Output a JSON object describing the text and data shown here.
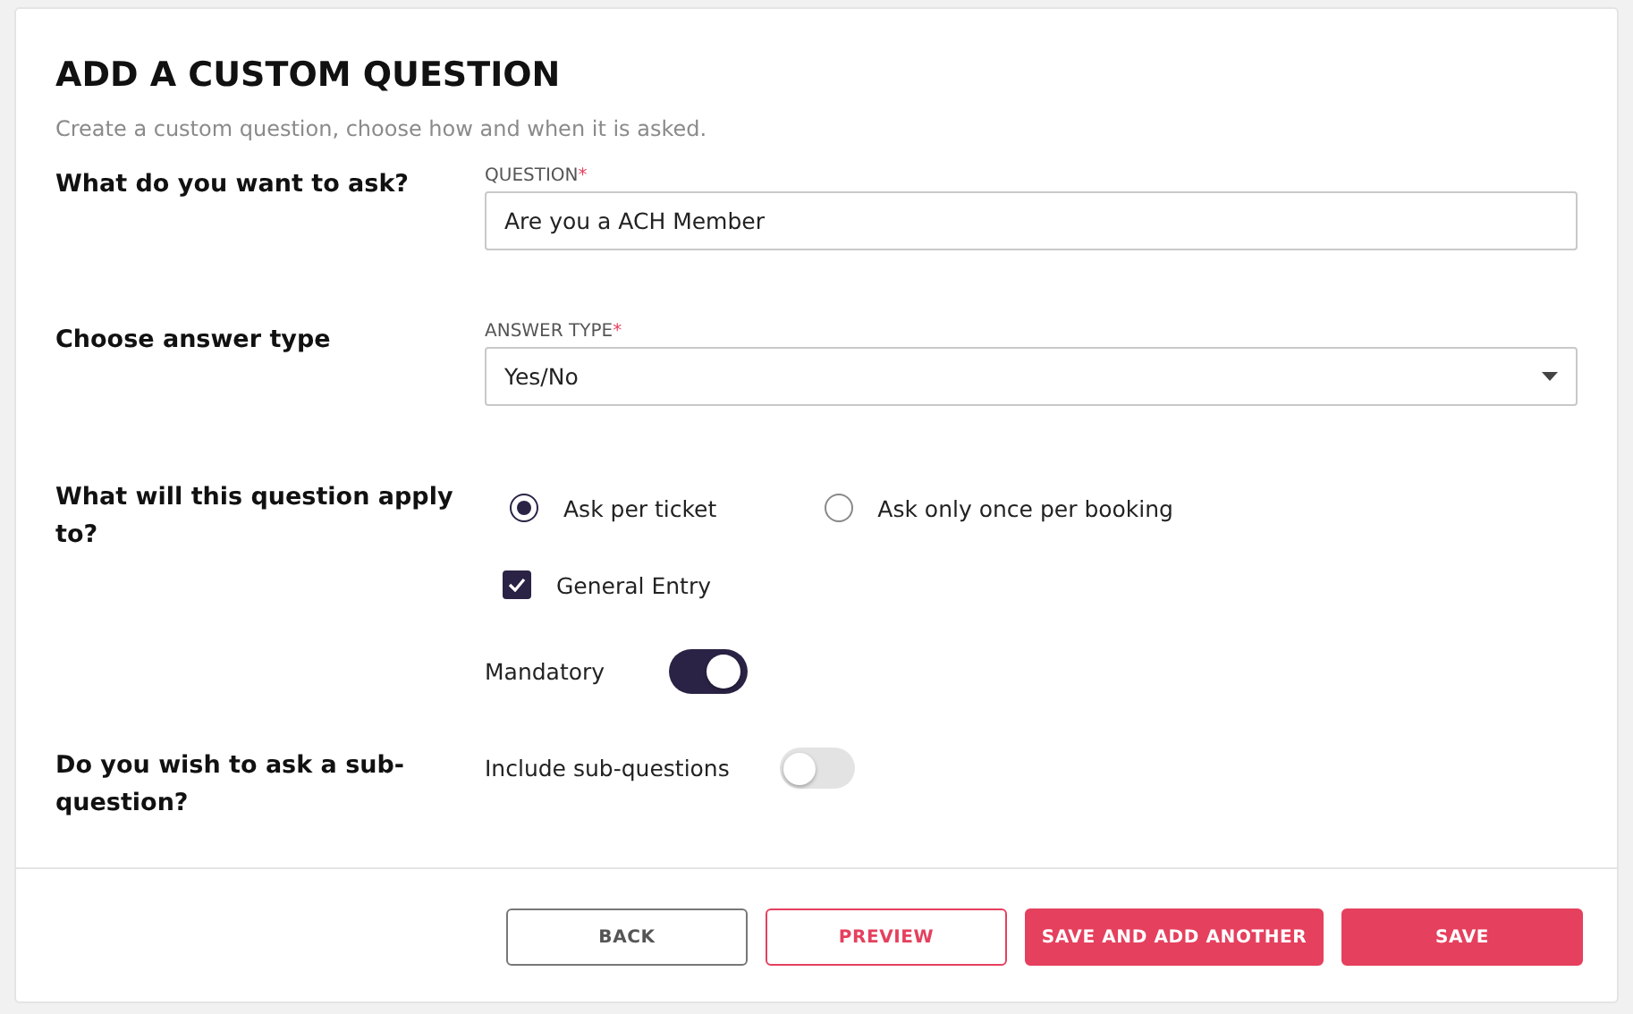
{
  "title": "ADD A CUSTOM QUESTION",
  "subtitle": "Create a custom question, choose how and when it is asked.",
  "sections": [
    {
      "kind": "text",
      "prompt": "What do you want to ask?",
      "field": {
        "label": "QUESTION",
        "required_mark": "*",
        "value": "Are you a ACH Member"
      }
    },
    {
      "kind": "select",
      "prompt": "Choose answer type",
      "field": {
        "label": "ANSWER TYPE",
        "required_mark": "*",
        "value": "Yes/No"
      }
    },
    {
      "kind": "apply",
      "prompt": "What will this question apply to?",
      "radios": [
        {
          "label": "Ask per ticket",
          "selected": true
        },
        {
          "label": "Ask only once per booking",
          "selected": false
        }
      ],
      "checkboxes": [
        {
          "label": "General Entry",
          "checked": true
        }
      ],
      "toggle": {
        "label": "Mandatory",
        "on": true
      }
    },
    {
      "kind": "toggle",
      "prompt": "Do you wish to ask a sub-question?",
      "toggle": {
        "label": "Include sub-questions",
        "on": false
      }
    }
  ],
  "buttons": [
    {
      "label": "BACK",
      "kind": "outline"
    },
    {
      "label": "PREVIEW",
      "kind": "accent-outline"
    },
    {
      "label": "SAVE AND ADD ANOTHER",
      "kind": "filled"
    },
    {
      "label": "SAVE",
      "kind": "filled"
    }
  ]
}
